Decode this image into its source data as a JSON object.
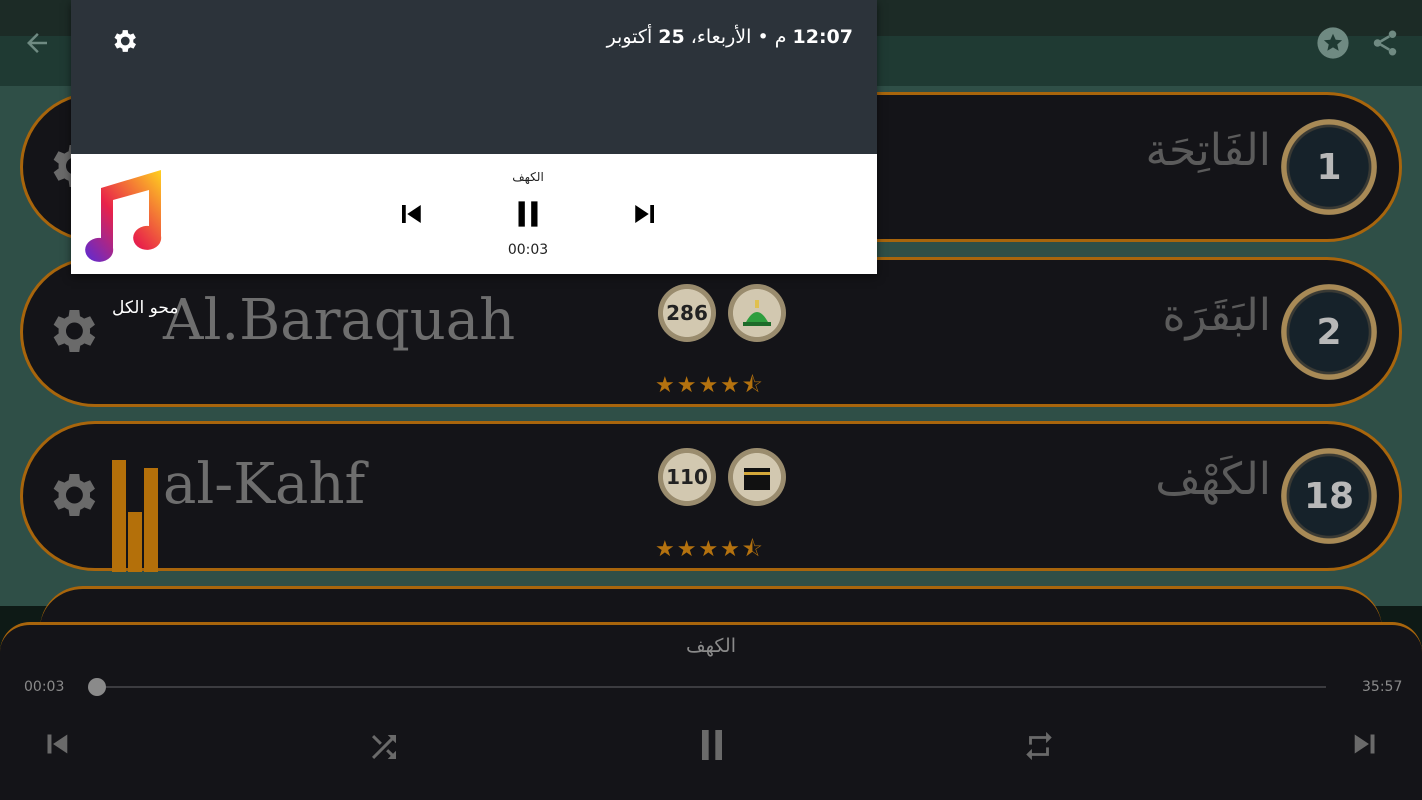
{
  "colors": {
    "accent": "#a8650c",
    "star": "#b4720f",
    "list_background": "#2f4f47",
    "card_background": "#141418"
  },
  "surahs": [
    {
      "number": "1",
      "arabic_name": "الفَاتِحَة",
      "english_name": "",
      "verse_count": "",
      "place_icon": "",
      "rating": ""
    },
    {
      "number": "2",
      "arabic_name": "البَقَرَة",
      "english_name": "Al.Baraquah",
      "verse_count": "286",
      "place_icon": "medina-mosque-icon",
      "stars": "★★★★⯪",
      "rating": 4.5
    },
    {
      "number": "18",
      "arabic_name": "الكَهْف",
      "english_name": "al-Kahf",
      "verse_count": "110",
      "place_icon": "kaaba-icon",
      "stars": "★★★★⯪",
      "rating": 4.5
    }
  ],
  "overlay": {
    "clear_all": "محو الكل"
  },
  "notification": {
    "time": "12:07",
    "time_suffix": "م",
    "separator": "•",
    "date_prefix": "الأربعاء،",
    "date_day": "25",
    "date_month": "أكتوبر",
    "media": {
      "title": "الكهف",
      "position": "00:03",
      "cover_icon": "music-note-icon"
    }
  },
  "player": {
    "title": "الكهف",
    "current_time": "00:03",
    "duration": "35:57",
    "progress_fraction": 0.0014
  }
}
